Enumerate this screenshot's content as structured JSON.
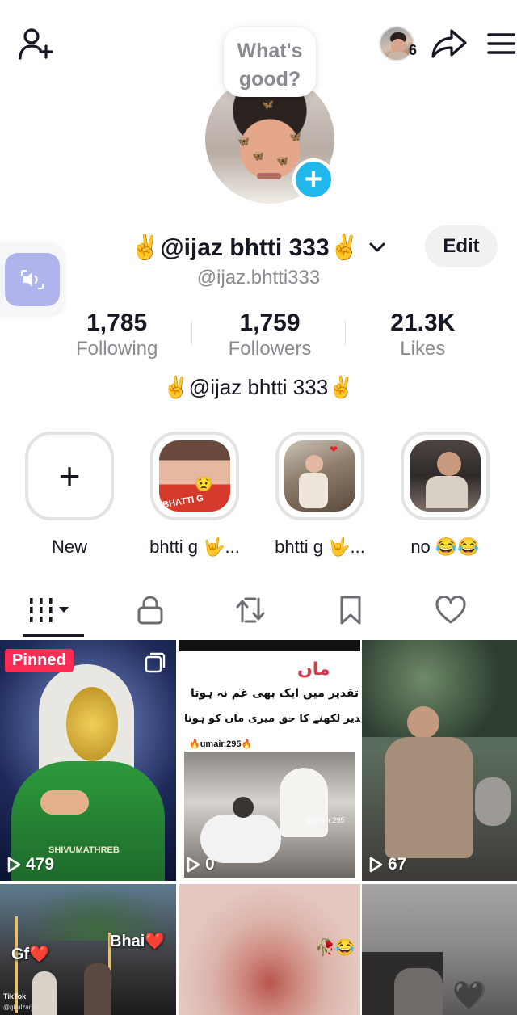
{
  "header": {
    "visitor_count": "6",
    "bubble_text": "What's good?"
  },
  "profile": {
    "display_name": "✌️@ijaz bhtti 333✌️",
    "edit_label": "Edit",
    "username": "@ijaz.bhtti333",
    "bio": "✌️@ijaz bhtti 333✌️"
  },
  "stats": [
    {
      "value": "1,785",
      "label": "Following"
    },
    {
      "value": "1,759",
      "label": "Followers"
    },
    {
      "value": "21.3K",
      "label": "Likes"
    }
  ],
  "highlights": [
    {
      "label": "New"
    },
    {
      "label": "bhtti g 🤟..."
    },
    {
      "label": "bhtti g 🤟..."
    },
    {
      "label": "no 😂😂"
    }
  ],
  "tabs": [
    "videos-tab",
    "private-tab",
    "reposts-tab",
    "favorites-tab",
    "liked-tab"
  ],
  "videos": [
    {
      "badge": "Pinned",
      "views": "479",
      "watermark": "SHIVUMATHREB"
    },
    {
      "views": "0",
      "title_urdu": "ماں",
      "line1": "میری تقدیر میں ایک بھی غم نہ ہوتا",
      "line2": "اگر تقدیر لکھنے کا حق میری ماں کو ہوتا..!!",
      "tag": "🔥umair.295🔥",
      "credit": "@umair.295"
    },
    {
      "views": "67"
    },
    {
      "label_left": "Gf❤️",
      "label_right": "Bhai❤️",
      "credit": "TikTok",
      "credit2": "@ghulzarjan"
    },
    {
      "emoji": "🥀😂"
    },
    {
      "emoji": "🖤"
    }
  ],
  "colors": {
    "accent_blue": "#20b8ea",
    "pinned_red": "#fe2c55",
    "muted_text": "#8a8b91",
    "sound_button": "#b0b4ec"
  }
}
